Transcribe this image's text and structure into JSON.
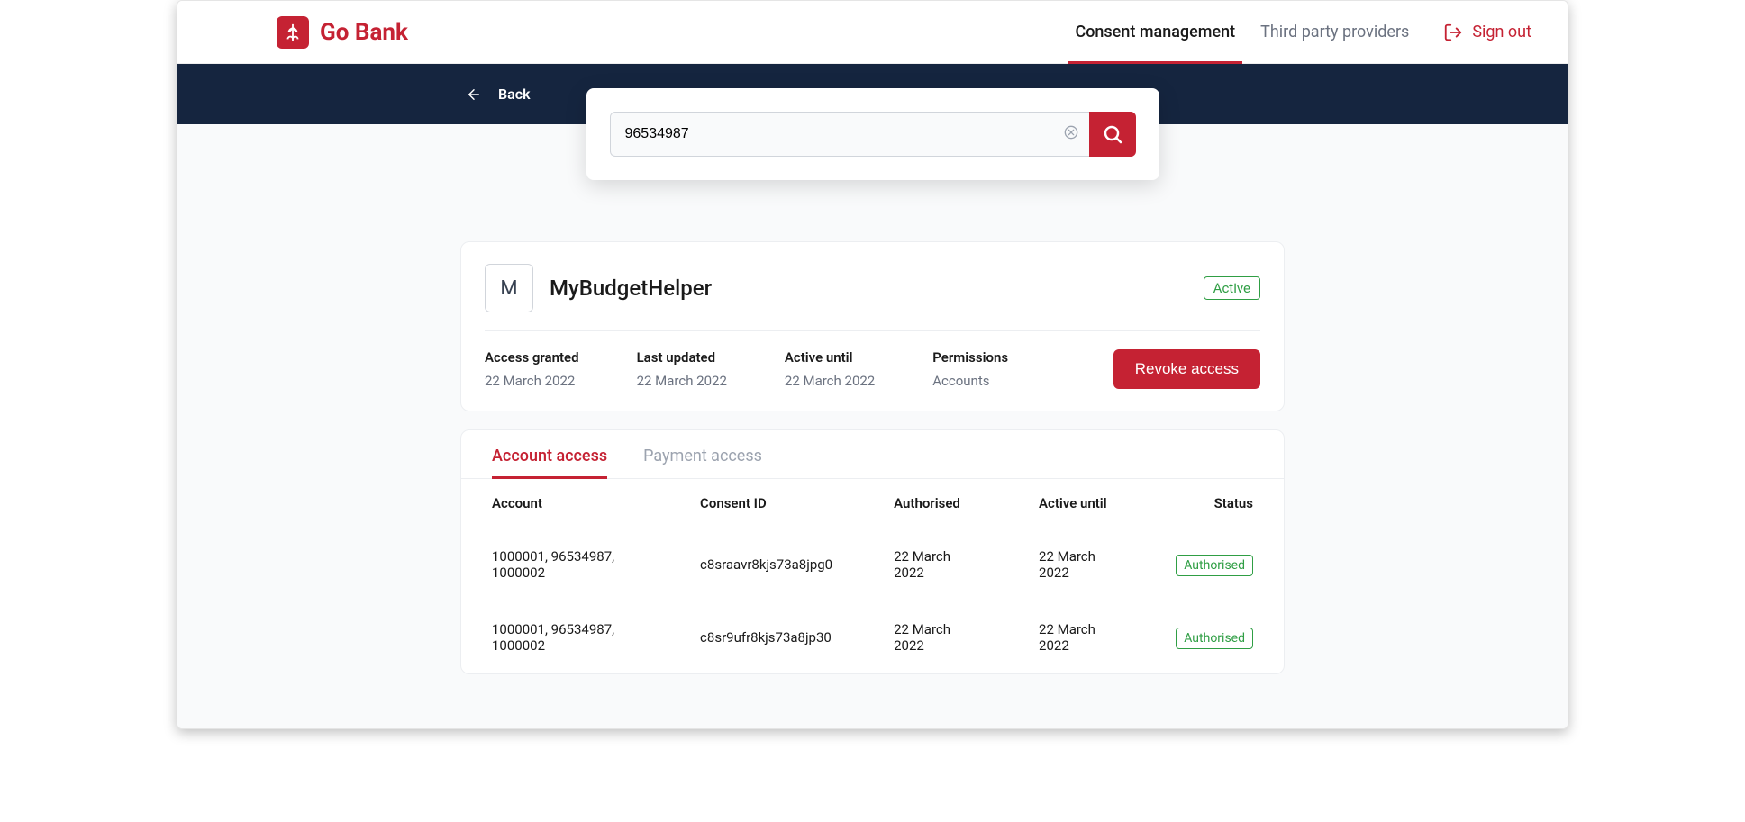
{
  "brand": {
    "name": "Go Bank"
  },
  "nav": {
    "consent": "Consent management",
    "tpp": "Third party providers",
    "signout": "Sign out"
  },
  "back": {
    "label": "Back"
  },
  "search": {
    "value": "96534987"
  },
  "provider": {
    "initial": "M",
    "name": "MyBudgetHelper",
    "status": "Active",
    "revoke_label": "Revoke access",
    "meta": {
      "access_granted": {
        "label": "Access granted",
        "value": "22 March 2022"
      },
      "last_updated": {
        "label": "Last updated",
        "value": "22 March 2022"
      },
      "active_until": {
        "label": "Active until",
        "value": "22 March 2022"
      },
      "permissions": {
        "label": "Permissions",
        "value": "Accounts"
      }
    }
  },
  "tabs": {
    "account": "Account access",
    "payment": "Payment access"
  },
  "table": {
    "headers": {
      "account": "Account",
      "consent_id": "Consent ID",
      "authorised": "Authorised",
      "active_until": "Active until",
      "status": "Status"
    },
    "rows": [
      {
        "account": "1000001, 96534987, 1000002",
        "consent_id": "c8sraavr8kjs73a8jpg0",
        "authorised": "22 March 2022",
        "active_until": "22 March 2022",
        "status": "Authorised"
      },
      {
        "account": "1000001, 96534987, 1000002",
        "consent_id": "c8sr9ufr8kjs73a8jp30",
        "authorised": "22 March 2022",
        "active_until": "22 March 2022",
        "status": "Authorised"
      }
    ]
  }
}
